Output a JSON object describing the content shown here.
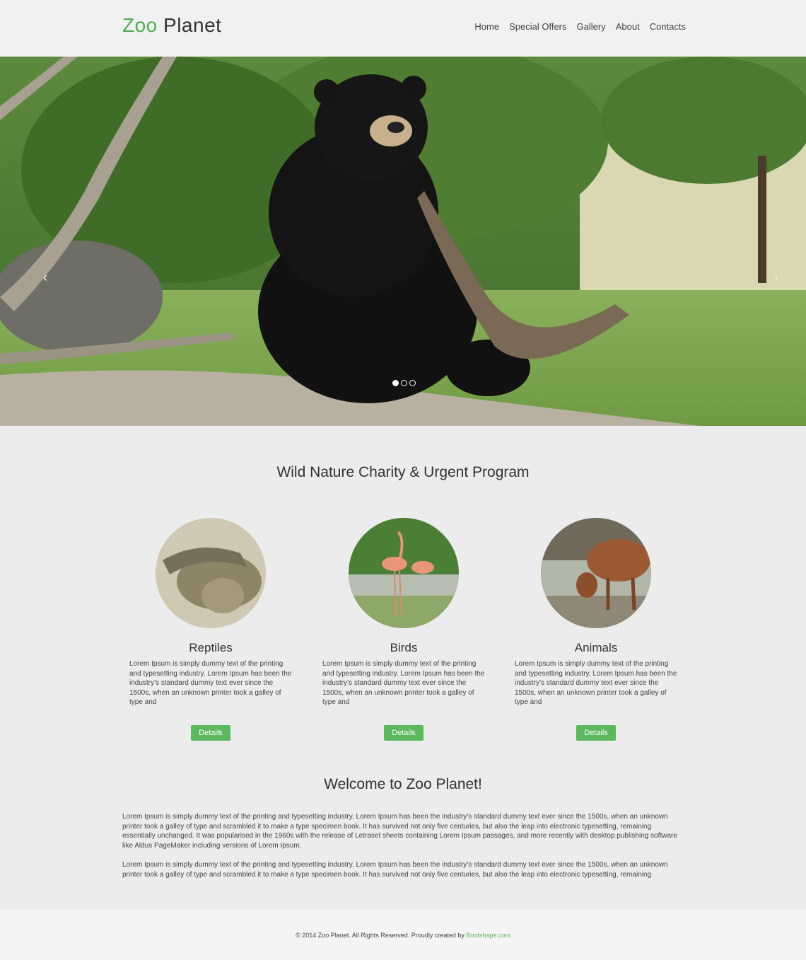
{
  "header": {
    "logo_zoo": "Zoo",
    "logo_planet": "Planet",
    "nav": [
      "Home",
      "Special Offers",
      "Gallery",
      "About",
      "Contacts"
    ]
  },
  "hero": {
    "arrow_prev": "‹",
    "arrow_next": "›",
    "slides": 3,
    "active_slide": 1
  },
  "section": {
    "title": "Wild Nature Charity & Urgent Program",
    "features": [
      {
        "title": "Reptiles",
        "text": "Lorem Ipsum is simply dummy text of the printing and typesetting industry. Lorem Ipsum has been the industry’s standard dummy text ever since the 1500s, when an unknown printer took a galley of type and",
        "button": "Details"
      },
      {
        "title": "Birds",
        "text": "Lorem Ipsum is simply dummy text of the printing and typesetting industry. Lorem Ipsum has been the industry’s standard dummy text ever since the 1500s, when an unknown printer took a galley of type and",
        "button": "Details"
      },
      {
        "title": "Animals",
        "text": "Lorem Ipsum is simply dummy text of the printing and typesetting industry. Lorem Ipsum has been the industry’s standard dummy text ever since the 1500s, when an unknown printer took a galley of type and",
        "button": "Details"
      }
    ]
  },
  "welcome": {
    "title": "Welcome to Zoo Planet!",
    "paragraph1": "Lorem Ipsum is simply dummy text of the printing and typesetting industry. Lorem Ipsum has been the industry’s standard dummy text ever since the 1500s, when an unknown printer took a galley of type and scrambled it to make a type specimen book. It has survived not only five centuries, but also the leap into electronic typesetting, remaining essentially unchanged. It was popularised in the 1960s with the release of Letraset sheets containing Lorem Ipsum passages, and more recently with desktop publishing software like Aldus PageMaker including versions of Lorem Ipsum.",
    "paragraph2": "Lorem Ipsum is simply dummy text of the printing and typesetting industry. Lorem Ipsum has been the industry’s standard dummy text ever since the 1500s, when an unknown printer took a galley of type and scrambled it to make a type specimen book. It has survived not only five centuries, but also the leap into electronic typesetting, remaining essentially unchan-"
  },
  "footer": {
    "copyright": "© 2014 Zoo Planet. All Rights Reserved. Proudly created by",
    "link": "Bootshape.com"
  }
}
